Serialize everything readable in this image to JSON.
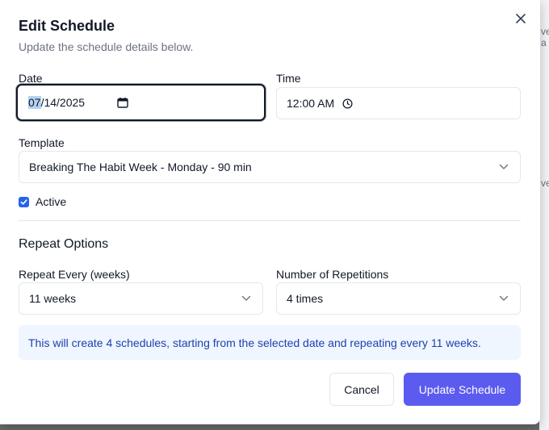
{
  "backdrop": {
    "fragments": [
      "ve",
      "a",
      "ve"
    ]
  },
  "dialog": {
    "title": "Edit Schedule",
    "subtitle": "Update the schedule details below.",
    "close_icon": "close-icon"
  },
  "date": {
    "label": "Date",
    "month": "07",
    "rest": "/14/2025",
    "icon": "calendar-icon"
  },
  "time": {
    "label": "Time",
    "value": "12:00 AM",
    "icon": "clock-icon"
  },
  "template": {
    "label": "Template",
    "value": "Breaking The Habit Week - Monday - 90 min",
    "icon": "chevron-down-icon"
  },
  "active": {
    "label": "Active",
    "checked": true
  },
  "repeat": {
    "section_title": "Repeat Options",
    "every_label": "Repeat Every (weeks)",
    "every_value": "11 weeks",
    "count_label": "Number of Repetitions",
    "count_value": "4 times",
    "info": "This will create 4 schedules, starting from the selected date and repeating every 11 weeks."
  },
  "actions": {
    "cancel": "Cancel",
    "submit": "Update Schedule"
  },
  "colors": {
    "primary": "#5b5bef",
    "info_bg": "#eff6ff",
    "info_text": "#1e40af",
    "checkbox": "#2563eb"
  }
}
